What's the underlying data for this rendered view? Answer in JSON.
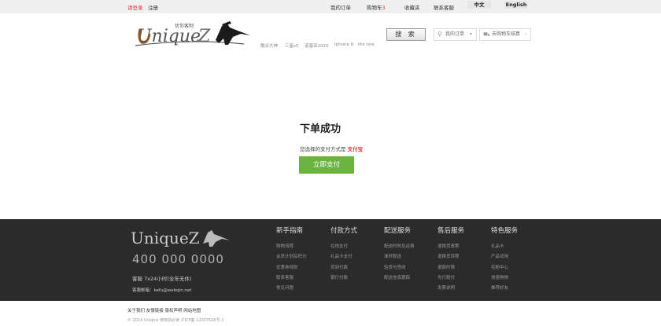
{
  "topbar": {
    "login": "请登录",
    "register": "注册",
    "my_orders": "我的订单",
    "cart": "购物车",
    "cart_count": "3",
    "favorites": "收藏夹",
    "contact": "联系客服",
    "lang_cn": "中文",
    "lang_en": "English"
  },
  "header": {
    "logo_text": "UniqueZ",
    "logo_sub": "优你客制",
    "hot_links": [
      "酷派大神",
      "三星s5",
      "诺基亚1020",
      "Iphone 6",
      "Iito one"
    ],
    "search_label": "搜 索",
    "my_order_btn": "我的订单",
    "cart_btn": "去购物车结算"
  },
  "main": {
    "title": "下单成功",
    "pay_text": "您选择的支付方式是",
    "pay_method": "支付宝",
    "pay_button": "立即支付"
  },
  "footer": {
    "logo_text": "UniqueZ",
    "phone": "400 000 0000",
    "service": "客服 7x24小时(全年无休)",
    "email_label": "客服邮箱：",
    "email": "kefu@webqin.net",
    "columns": [
      {
        "title": "新手指南",
        "items": [
          "购物流程",
          "会员计划及积分",
          "优惠券规则",
          "联系客服",
          "常见问题"
        ]
      },
      {
        "title": "付款方式",
        "items": [
          "在线支付",
          "礼品卡支付",
          "货到付款",
          "银行付款"
        ]
      },
      {
        "title": "配送服务",
        "items": [
          "配送时效及运费",
          "准时配送",
          "验货与签收",
          "配送信息跟踪"
        ]
      },
      {
        "title": "售后服务",
        "items": [
          "退换货政策",
          "退换货流程",
          "退款时限",
          "先行赔付",
          "发票说明"
        ]
      },
      {
        "title": "特色服务",
        "items": [
          "礼品卡",
          "产品试用",
          "花粉中心",
          "快速购物",
          "推荐好友"
        ]
      }
    ]
  },
  "bottom": {
    "links": "关于我们 友情链接 版权声明 网站地图",
    "copyright": "© 2014 Uniqeiz 使用前必读 沪ICP备 12007626号-1"
  }
}
